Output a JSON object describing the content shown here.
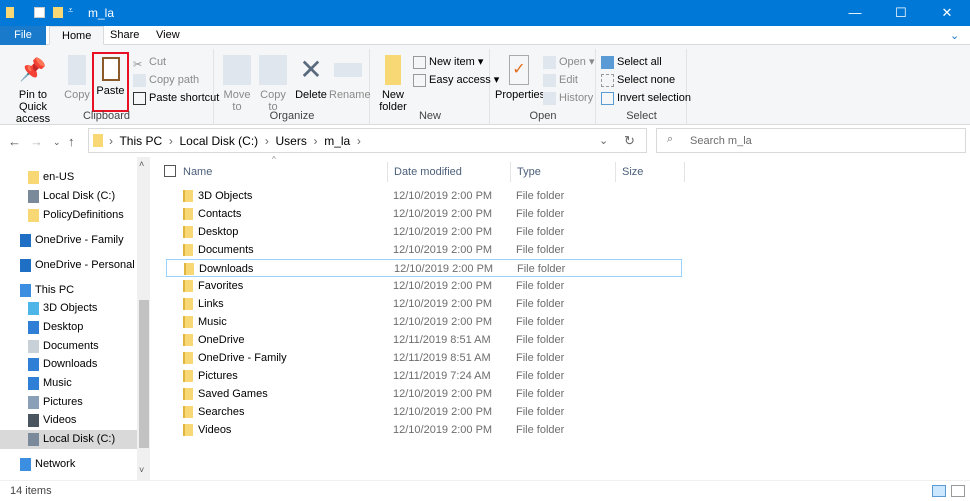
{
  "window": {
    "title": "m_la",
    "minimize": "—",
    "maximize": "☐",
    "close": "✕"
  },
  "tabs": [
    "File",
    "Home",
    "Share",
    "View"
  ],
  "ribbon": {
    "clipboard": {
      "label": "Clipboard",
      "pin": "Pin to Quick access",
      "copy": "Copy",
      "paste": "Paste",
      "cut": "Cut",
      "copy_path": "Copy path",
      "paste_shortcut": "Paste shortcut"
    },
    "organize": {
      "label": "Organize",
      "move_to": "Move to",
      "copy_to": "Copy to",
      "delete": "Delete",
      "rename": "Rename"
    },
    "new": {
      "label": "New",
      "new_folder": "New folder",
      "new_item": "New item ▾",
      "easy_access": "Easy access ▾"
    },
    "open": {
      "label": "Open",
      "properties": "Properties",
      "open": "Open ▾",
      "edit": "Edit",
      "history": "History"
    },
    "select": {
      "label": "Select",
      "select_all": "Select all",
      "select_none": "Select none",
      "invert": "Invert selection"
    },
    "highlight_color": "#e81123"
  },
  "address": {
    "crumbs": [
      "This PC",
      "Local Disk (C:)",
      "Users",
      "m_la"
    ],
    "search_placeholder": "Search m_la"
  },
  "sidebar": [
    {
      "label": "en-US",
      "icon": "folder-icon"
    },
    {
      "label": "Local Disk (C:)",
      "icon": "drive-icon"
    },
    {
      "label": "PolicyDefinitions",
      "icon": "folder-icon"
    },
    {
      "label": "OneDrive - Family",
      "icon": "cloud-icon"
    },
    {
      "label": "OneDrive - Personal",
      "icon": "cloud-icon"
    },
    {
      "label": "This PC",
      "icon": "computer-icon"
    },
    {
      "label": "3D Objects",
      "icon": "cube-icon"
    },
    {
      "label": "Desktop",
      "icon": "desktop-icon"
    },
    {
      "label": "Documents",
      "icon": "document-icon"
    },
    {
      "label": "Downloads",
      "icon": "download-icon"
    },
    {
      "label": "Music",
      "icon": "music-icon"
    },
    {
      "label": "Pictures",
      "icon": "picture-icon"
    },
    {
      "label": "Videos",
      "icon": "video-icon"
    },
    {
      "label": "Local Disk (C:)",
      "icon": "drive-icon",
      "selected": true
    },
    {
      "label": "Network",
      "icon": "network-icon"
    }
  ],
  "columns": [
    "Name",
    "Date modified",
    "Type",
    "Size"
  ],
  "files": [
    {
      "name": "3D Objects",
      "date": "12/10/2019 2:00 PM",
      "type": "File folder"
    },
    {
      "name": "Contacts",
      "date": "12/10/2019 2:00 PM",
      "type": "File folder"
    },
    {
      "name": "Desktop",
      "date": "12/10/2019 2:00 PM",
      "type": "File folder"
    },
    {
      "name": "Documents",
      "date": "12/10/2019 2:00 PM",
      "type": "File folder"
    },
    {
      "name": "Downloads",
      "date": "12/10/2019 2:00 PM",
      "type": "File folder",
      "selected": true
    },
    {
      "name": "Favorites",
      "date": "12/10/2019 2:00 PM",
      "type": "File folder"
    },
    {
      "name": "Links",
      "date": "12/10/2019 2:00 PM",
      "type": "File folder"
    },
    {
      "name": "Music",
      "date": "12/10/2019 2:00 PM",
      "type": "File folder"
    },
    {
      "name": "OneDrive",
      "date": "12/11/2019 8:51 AM",
      "type": "File folder"
    },
    {
      "name": "OneDrive - Family",
      "date": "12/11/2019 8:51 AM",
      "type": "File folder"
    },
    {
      "name": "Pictures",
      "date": "12/11/2019 7:24 AM",
      "type": "File folder"
    },
    {
      "name": "Saved Games",
      "date": "12/10/2019 2:00 PM",
      "type": "File folder"
    },
    {
      "name": "Searches",
      "date": "12/10/2019 2:00 PM",
      "type": "File folder"
    },
    {
      "name": "Videos",
      "date": "12/10/2019 2:00 PM",
      "type": "File folder"
    }
  ],
  "status": "14 items"
}
